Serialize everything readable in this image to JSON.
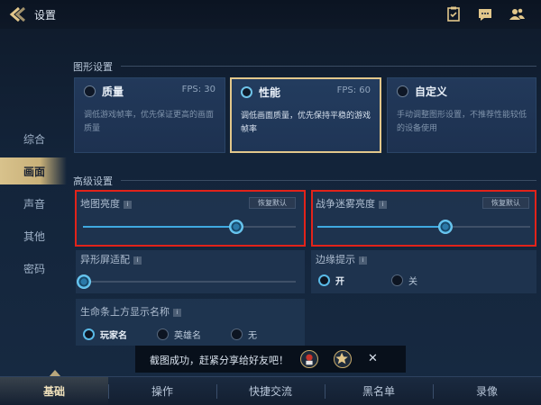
{
  "header": {
    "title": "设置"
  },
  "sidebar": {
    "items": [
      {
        "label": "综合"
      },
      {
        "label": "画面"
      },
      {
        "label": "声音"
      },
      {
        "label": "其他"
      },
      {
        "label": "密码"
      }
    ],
    "active_index": 1
  },
  "graphics": {
    "heading": "图形设置",
    "options": [
      {
        "name": "质量",
        "fps": "FPS: 30",
        "desc": "调低游戏帧率，优先保证更高的画面质量",
        "selected": false
      },
      {
        "name": "性能",
        "fps": "FPS: 60",
        "desc": "调低画面质量，优先保持平稳的游戏帧率",
        "selected": true
      },
      {
        "name": "自定义",
        "fps": "",
        "desc": "手动调整图形设置，不推荐性能较低的设备使用",
        "selected": false
      }
    ]
  },
  "advanced": {
    "heading": "高级设置",
    "map_brightness": {
      "label": "地图亮度",
      "reset": "恢复默认",
      "value": 0.72
    },
    "fog_brightness": {
      "label": "战争迷雾亮度",
      "reset": "恢复默认",
      "value": 0.6
    },
    "notch_adapt": {
      "label": "异形屏适配",
      "value": 0.0
    },
    "edge_hint": {
      "label": "边缘提示",
      "options": [
        "开",
        "关"
      ],
      "selected": "开"
    },
    "healthbar_name": {
      "label": "生命条上方显示名称",
      "options": [
        "玩家名",
        "英雄名",
        "无"
      ],
      "selected": "玩家名"
    }
  },
  "toast": {
    "text": "截图成功，赶紧分享给好友吧！",
    "close": "✕"
  },
  "bottom_tabs": {
    "items": [
      {
        "label": "基础"
      },
      {
        "label": "操作"
      },
      {
        "label": "快捷交流"
      },
      {
        "label": "黑名单"
      },
      {
        "label": "录像"
      }
    ],
    "active_index": 0
  },
  "colors": {
    "accent_gold": "#e2c78b",
    "slider_blue": "#3fa9e0",
    "highlight_red": "#e2231a"
  },
  "icons": [
    "back-arrow-icon",
    "task-icon",
    "chat-icon",
    "friends-icon",
    "info-icon",
    "share-avatar-icon",
    "star-icon",
    "close-icon"
  ]
}
